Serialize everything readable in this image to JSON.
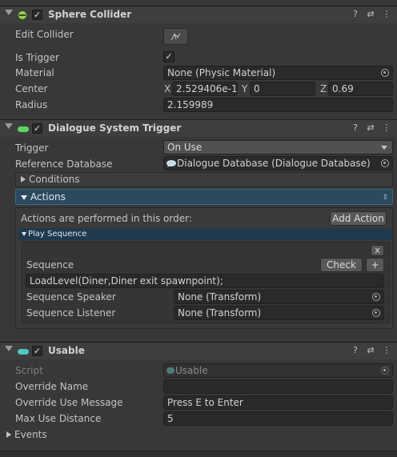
{
  "sphere_collider": {
    "title": "Sphere Collider",
    "enabled": true,
    "edit_collider_label": "Edit Collider",
    "is_trigger_label": "Is Trigger",
    "is_trigger_value": "✓",
    "material_label": "Material",
    "material_value": "None (Physic Material)",
    "center_label": "Center",
    "center": {
      "x_label": "X",
      "x": "2.529406e-1",
      "y_label": "Y",
      "y": "0",
      "z_label": "Z",
      "z": "0.69"
    },
    "radius_label": "Radius",
    "radius_value": "2.159989"
  },
  "dialogue_trigger": {
    "title": "Dialogue System Trigger",
    "trigger_label": "Trigger",
    "trigger_value": "On Use",
    "reference_db_label": "Reference Database",
    "reference_db_value": "Dialogue Database (Dialogue Database)",
    "conditions_label": "Conditions",
    "actions_label": "Actions",
    "actions_desc": "Actions are performed in this order:",
    "add_action_label": "Add Action",
    "play_sequence_label": "Play Sequence",
    "remove_label": "x",
    "sequence_label": "Sequence",
    "check_label": "Check",
    "plus_label": "+",
    "sequence_value": "LoadLevel(Diner,Diner exit spawnpoint);",
    "speaker_label": "Sequence Speaker",
    "speaker_value": "None (Transform)",
    "listener_label": "Sequence Listener",
    "listener_value": "None (Transform)"
  },
  "usable": {
    "title": "Usable",
    "script_label": "Script",
    "script_value": "Usable",
    "override_name_label": "Override Name",
    "override_name_value": "",
    "override_msg_label": "Override Use Message",
    "override_msg_value": "Press E to Enter",
    "max_distance_label": "Max Use Distance",
    "max_distance_value": "5",
    "events_label": "Events"
  },
  "header_icons": {
    "help": "?",
    "settings": "⇄",
    "more": "⋮"
  },
  "colors": {
    "actions_bar": "#2c4a5e",
    "play_sequence_bar": "#1f3a4d",
    "background": "#383838"
  }
}
